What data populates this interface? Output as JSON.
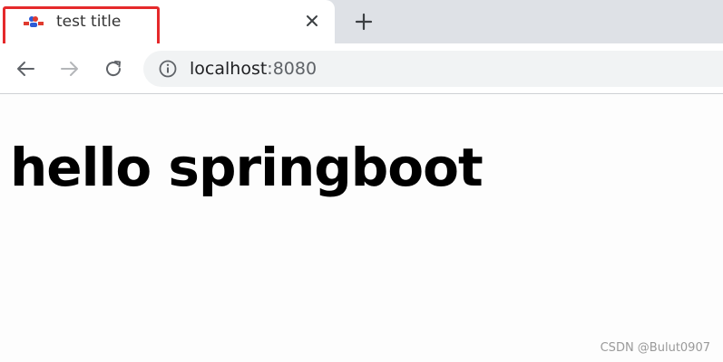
{
  "tab": {
    "title": "test title",
    "favicon": "baidu-favicon-icon",
    "close": "close-icon"
  },
  "new_tab": "plus-icon",
  "nav": {
    "back": "back-arrow-icon",
    "forward": "forward-arrow-icon",
    "reload": "reload-icon"
  },
  "address_bar": {
    "info": "info-icon",
    "host": "localhost",
    "port": ":8080"
  },
  "page": {
    "heading": "hello springboot"
  },
  "watermark": "CSDN @Bulut0907",
  "colors": {
    "highlight": "#e5292b",
    "tabstrip": "#dee1e6",
    "omnibox": "#f1f3f4"
  }
}
